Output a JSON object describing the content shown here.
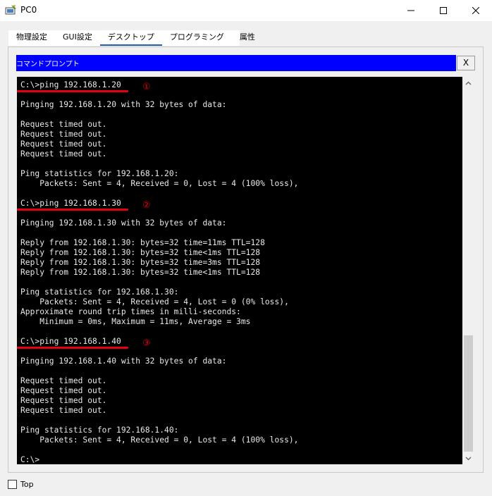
{
  "window": {
    "title": "PC0"
  },
  "tabs": [
    {
      "label": "物理設定"
    },
    {
      "label": "GUI設定"
    },
    {
      "label": "デスクトップ"
    },
    {
      "label": "プログラミング"
    },
    {
      "label": "属性"
    }
  ],
  "active_tab": "デスクトップ",
  "command_prompt": {
    "title": "コマンドプロンプト",
    "close_label": "X",
    "lines": [
      "C:\\>ping 192.168.1.20",
      "",
      "Pinging 192.168.1.20 with 32 bytes of data:",
      "",
      "Request timed out.",
      "Request timed out.",
      "Request timed out.",
      "Request timed out.",
      "",
      "Ping statistics for 192.168.1.20:",
      "    Packets: Sent = 4, Received = 0, Lost = 4 (100% loss),",
      "",
      "C:\\>ping 192.168.1.30",
      "",
      "Pinging 192.168.1.30 with 32 bytes of data:",
      "",
      "Reply from 192.168.1.30: bytes=32 time=11ms TTL=128",
      "Reply from 192.168.1.30: bytes=32 time<1ms TTL=128",
      "Reply from 192.168.1.30: bytes=32 time=3ms TTL=128",
      "Reply from 192.168.1.30: bytes=32 time<1ms TTL=128",
      "",
      "Ping statistics for 192.168.1.30:",
      "    Packets: Sent = 4, Received = 4, Lost = 0 (0% loss),",
      "Approximate round trip times in milli-seconds:",
      "    Minimum = 0ms, Maximum = 11ms, Average = 3ms",
      "",
      "C:\\>ping 192.168.1.40",
      "",
      "Pinging 192.168.1.40 with 32 bytes of data:",
      "",
      "Request timed out.",
      "Request timed out.",
      "Request timed out.",
      "Request timed out.",
      "",
      "Ping statistics for 192.168.1.40:",
      "    Packets: Sent = 4, Received = 0, Lost = 4 (100% loss),",
      "",
      "C:\\>"
    ],
    "annotations": [
      {
        "marker": "①",
        "line": 0
      },
      {
        "marker": "②",
        "line": 12
      },
      {
        "marker": "③",
        "line": 26
      }
    ],
    "annotation_color": "#e60012"
  },
  "top_checkbox": {
    "label": "Top",
    "checked": false
  },
  "colors": {
    "header_blue": "#0000ff",
    "terminal_bg": "#000000",
    "terminal_text": "#e8e8e8",
    "active_tab_underline": "#1e5db5"
  }
}
